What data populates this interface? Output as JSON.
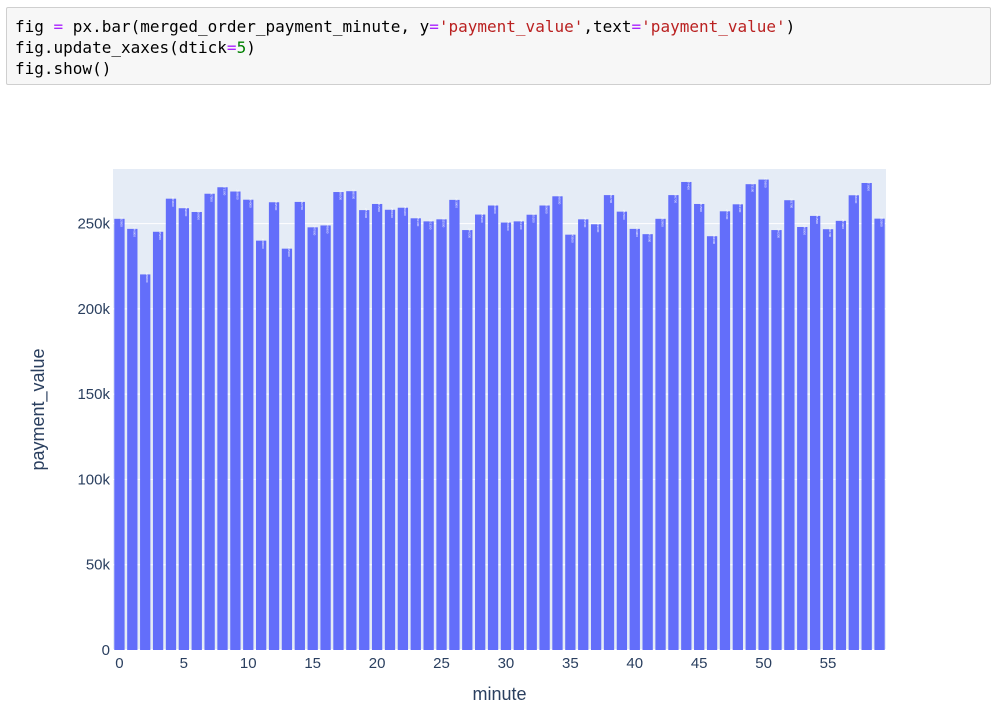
{
  "code_cell": {
    "lines": [
      [
        {
          "t": "fig ",
          "c": ""
        },
        {
          "t": "=",
          "c": "tok-op"
        },
        {
          "t": " px.bar(merged_order_payment_minute, y",
          "c": ""
        },
        {
          "t": "=",
          "c": "tok-op"
        },
        {
          "t": "'payment_value'",
          "c": "tok-str"
        },
        {
          "t": ",text",
          "c": ""
        },
        {
          "t": "=",
          "c": "tok-op"
        },
        {
          "t": "'payment_value'",
          "c": "tok-str"
        },
        {
          "t": ")",
          "c": ""
        }
      ],
      [
        {
          "t": "fig.update_xaxes(dtick",
          "c": ""
        },
        {
          "t": "=",
          "c": "tok-op"
        },
        {
          "t": "5",
          "c": "tok-num"
        },
        {
          "t": ")",
          "c": ""
        }
      ],
      [
        {
          "t": "fig.show()",
          "c": ""
        }
      ]
    ]
  },
  "chart_data": {
    "type": "bar",
    "x": [
      0,
      1,
      2,
      3,
      4,
      5,
      6,
      7,
      8,
      9,
      10,
      11,
      12,
      13,
      14,
      15,
      16,
      17,
      18,
      19,
      20,
      21,
      22,
      23,
      24,
      25,
      26,
      27,
      28,
      29,
      30,
      31,
      32,
      33,
      34,
      35,
      36,
      37,
      38,
      39,
      40,
      41,
      42,
      43,
      44,
      45,
      46,
      47,
      48,
      49,
      50,
      51,
      52,
      53,
      54,
      55,
      56,
      57,
      58,
      59
    ],
    "series": [
      {
        "values": [
          252800,
          246900,
          220200,
          245200,
          264600,
          259000,
          256800,
          267500,
          271300,
          268800,
          264000,
          240000,
          262500,
          235300,
          262700,
          247800,
          248900,
          268500,
          269000,
          257900,
          261500,
          258100,
          259300,
          253100,
          251300,
          252500,
          263900,
          246200,
          255300,
          260600,
          250600,
          251300,
          255200,
          260600,
          266000,
          243500,
          252500,
          249600,
          266700,
          257000,
          246900,
          243800,
          252800,
          266700,
          274400,
          261500,
          242600,
          257200,
          261300,
          273100,
          275800,
          246200,
          263700,
          248000,
          254500,
          246700,
          251600,
          266600,
          273800,
          252900
        ],
        "color": "#636efa"
      }
    ],
    "xlabel": "minute",
    "ylabel": "payment_value",
    "ylim": [
      0,
      282000
    ],
    "xticks": [
      0,
      5,
      10,
      15,
      20,
      25,
      30,
      35,
      40,
      45,
      50,
      55
    ],
    "yticks": [
      0,
      50000,
      100000,
      150000,
      200000,
      250000
    ],
    "ytick_labels": [
      "0",
      "50k",
      "100k",
      "150k",
      "200k",
      "250k"
    ],
    "data_labels": "inside",
    "grid": true,
    "background": "#e5ecf6"
  }
}
